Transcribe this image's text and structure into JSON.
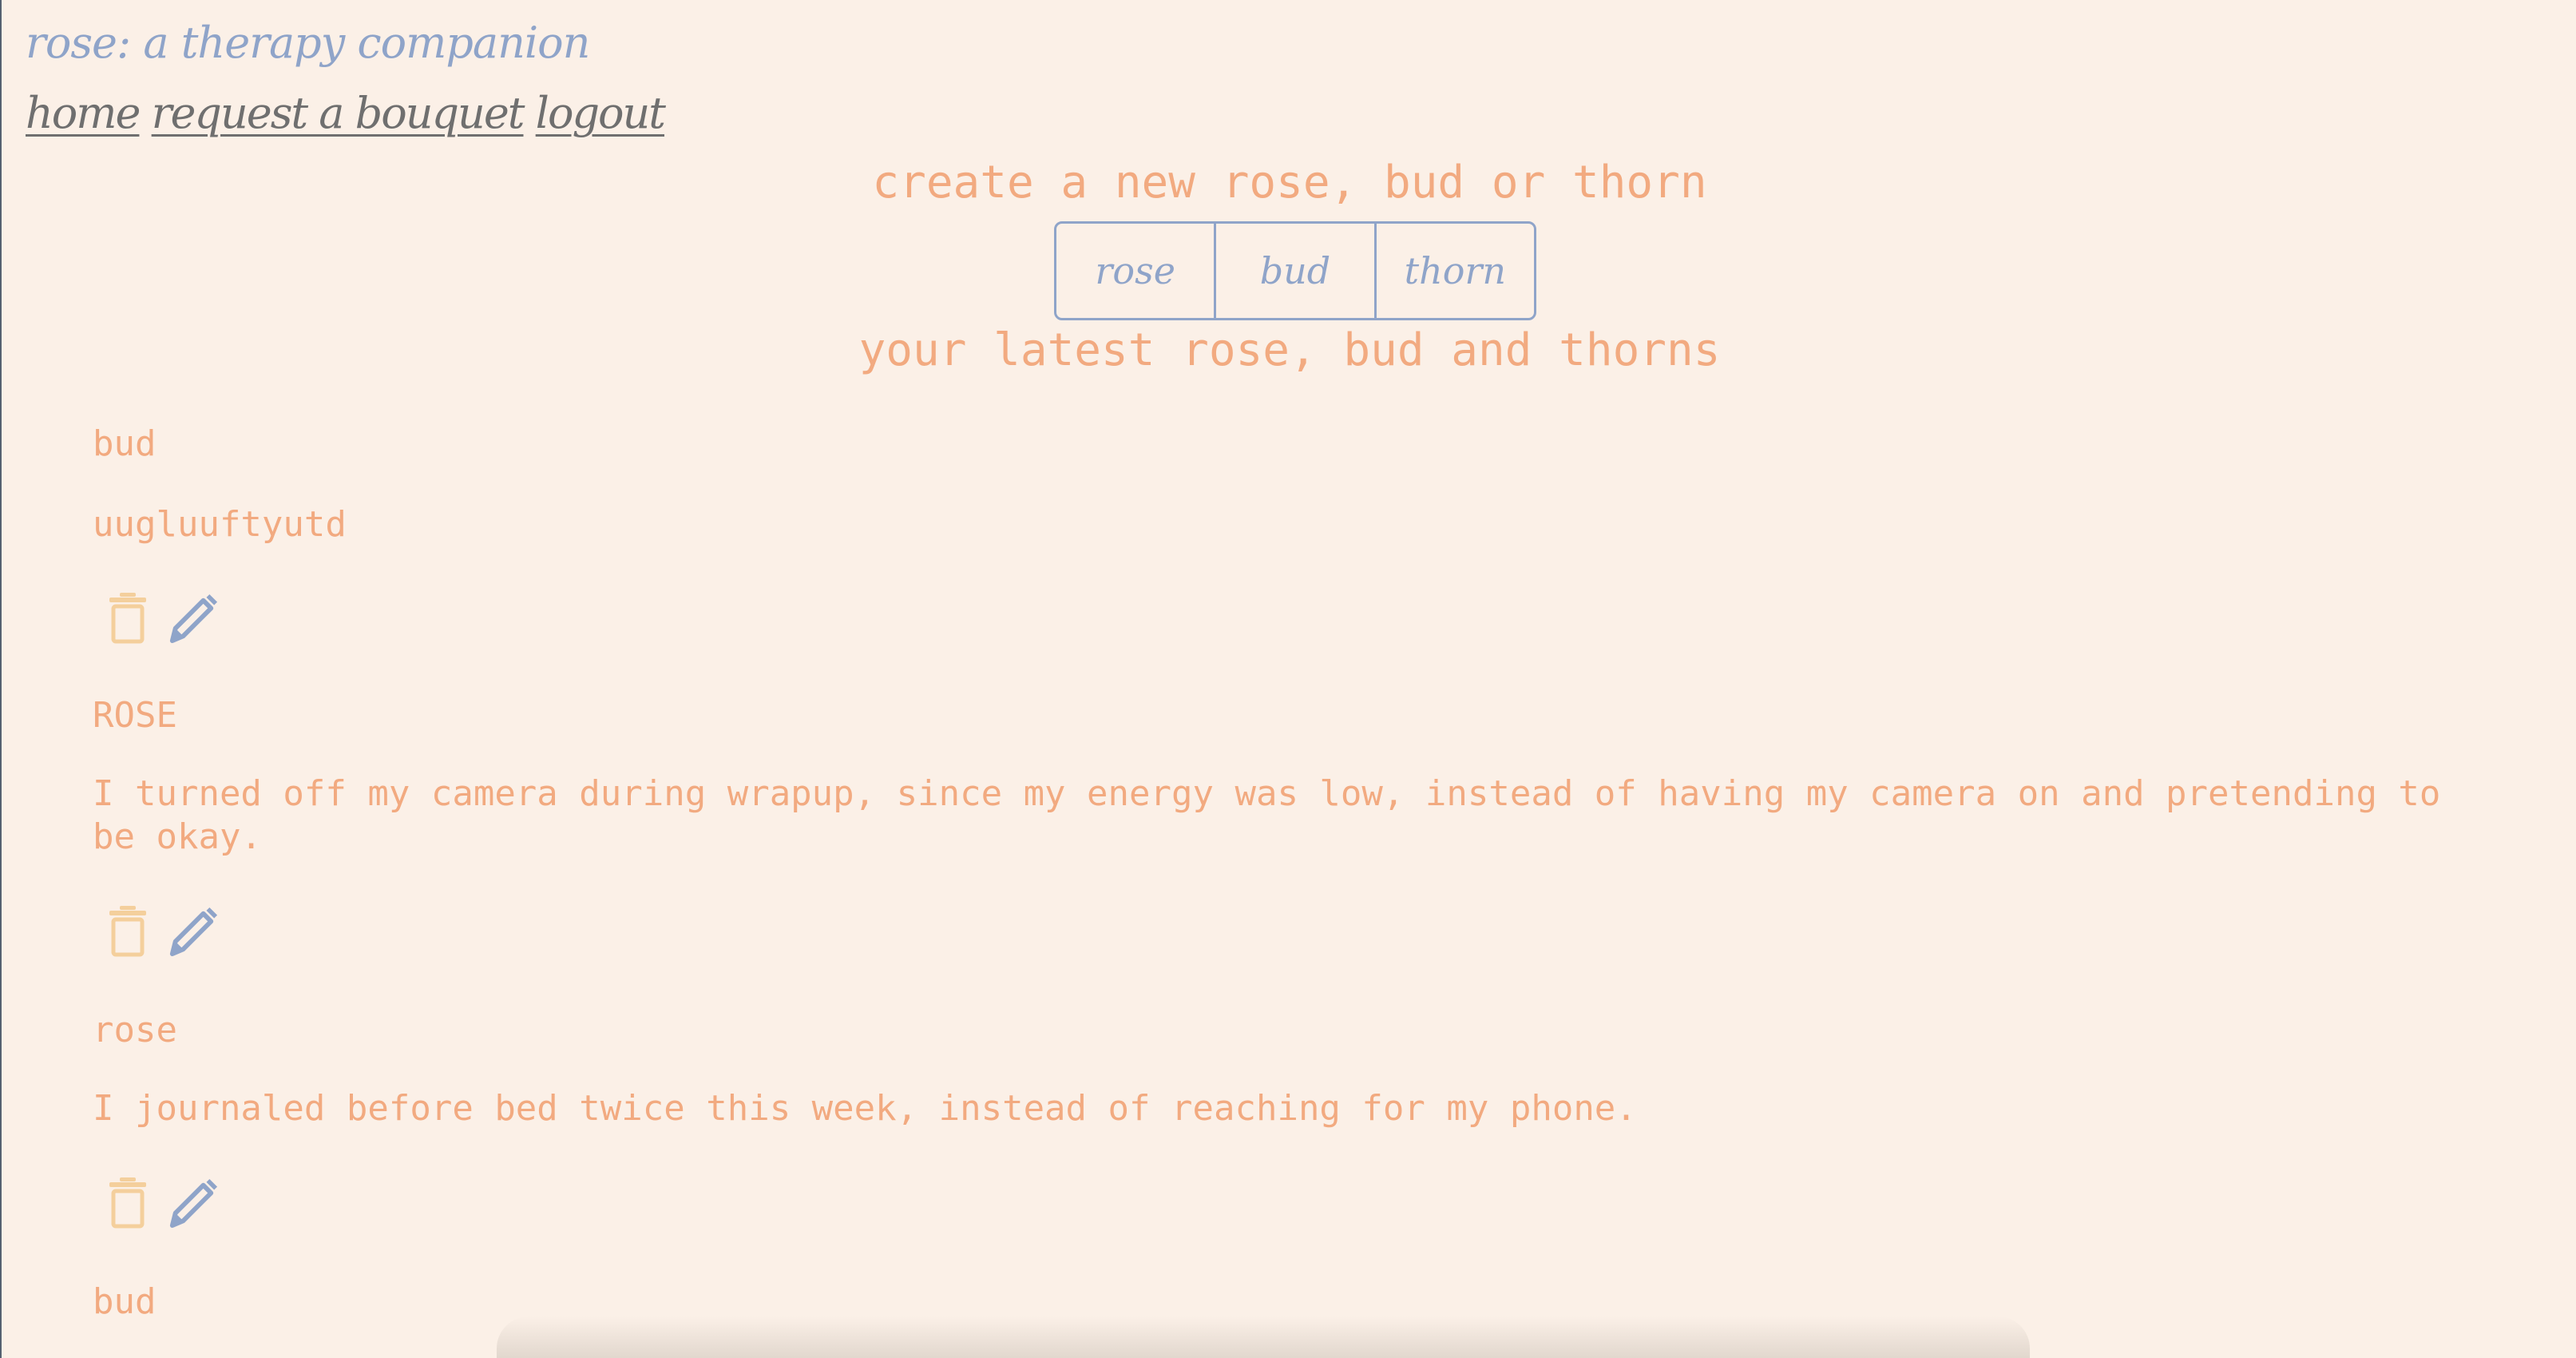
{
  "app": {
    "title": "rose: a therapy companion"
  },
  "nav": {
    "home": "home",
    "request": "request a bouquet",
    "logout": "logout"
  },
  "create": {
    "title": "create a new rose, bud or thorn",
    "types": [
      "rose",
      "bud",
      "thorn"
    ]
  },
  "latest": {
    "title": "your latest rose, bud and thorns"
  },
  "entries": [
    {
      "type": "bud",
      "text": "uugluuftyutd"
    },
    {
      "type": "ROSE",
      "text": "I turned off my camera during wrapup, since my energy was low, instead of having my camera on and pretending to be okay."
    },
    {
      "type": "rose",
      "text": "I journaled before bed twice this week, instead of reaching for my phone."
    },
    {
      "type": "bud",
      "text": ""
    }
  ],
  "icons": {
    "delete": "trash-icon",
    "edit": "pencil-icon"
  },
  "colors": {
    "background": "#fbf0e7",
    "accent_peach": "#f2aa80",
    "accent_blue": "#8fa4c9",
    "trash_yellow": "#f4cf9c",
    "nav_gray": "#6f6f6f"
  }
}
